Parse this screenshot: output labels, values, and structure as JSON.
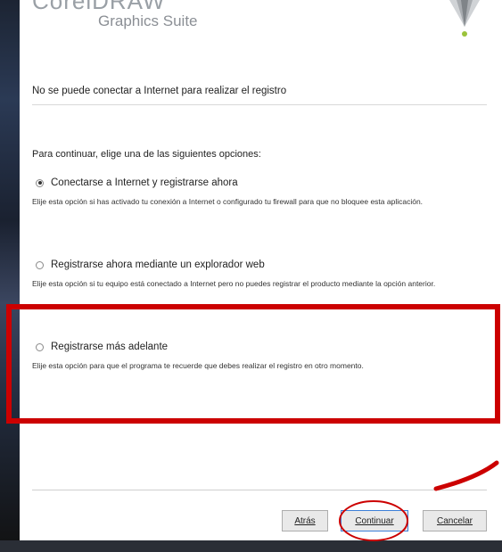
{
  "header": {
    "logo_text": "CorelDRAW",
    "logo_subtitle": "Graphics Suite"
  },
  "dialog": {
    "title": "No se puede conectar a Internet para realizar el registro",
    "prompt": "Para continuar, elige una de las siguientes opciones:",
    "options": [
      {
        "label": "Conectarse a Internet y registrarse ahora",
        "description": "Elije esta opción si has activado tu conexión a Internet o configurado tu firewall para que no bloquee esta aplicación.",
        "selected": true
      },
      {
        "label": "Registrarse ahora mediante un explorador web",
        "description": "Elije esta opción si tu equipo está conectado a Internet pero no puedes registrar el producto mediante la opción anterior.",
        "selected": false
      },
      {
        "label": "Registrarse más adelante",
        "description": "Elije esta opción para que el programa te recuerde que debes realizar el registro en otro momento.",
        "selected": false
      }
    ]
  },
  "buttons": {
    "back": "Atrás",
    "continue": "Continuar",
    "cancel": "Cancelar"
  },
  "annotation_colors": {
    "highlight": "#cc0000"
  }
}
